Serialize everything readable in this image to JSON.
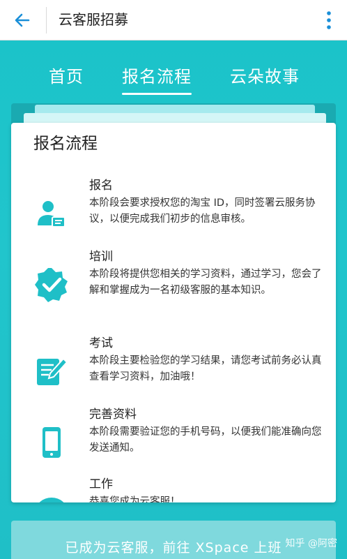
{
  "appbar": {
    "title": "云客服招募"
  },
  "tabs": [
    {
      "label": "首页"
    },
    {
      "label": "报名流程"
    },
    {
      "label": "云朵故事"
    }
  ],
  "card": {
    "title": "报名流程",
    "steps": [
      {
        "name": "报名",
        "desc": "本阶段会要求授权您的淘宝 ID，同时签署云服务协议，以便完成我们初步的信息审核。",
        "icon": "user-card-icon"
      },
      {
        "name": "培训",
        "desc": "本阶段将提供您相关的学习资料，通过学习，您会了解和掌握成为一名初级客服的基本知识。",
        "icon": "badge-check-icon"
      },
      {
        "name": "考试",
        "desc": "本阶段主要检验您的学习结果，请您考试前务必认真查看学习资料，加油哦！",
        "icon": "exam-edit-icon"
      },
      {
        "name": "完善资料",
        "desc": "本阶段需要验证您的手机号码，以便我们能准确向您发送通知。",
        "icon": "phone-icon"
      },
      {
        "name": "工作",
        "desc": "恭喜您成为云客服！",
        "icon": "chat-bubble-icon"
      }
    ]
  },
  "bottom_button": {
    "label": "已成为云客服，前往 XSpace 上班"
  },
  "watermark": "知乎 @阿密",
  "colors": {
    "accent": "#20c4cb",
    "icon": "#1fbfc7",
    "back_arrow": "#1a8fd8"
  }
}
